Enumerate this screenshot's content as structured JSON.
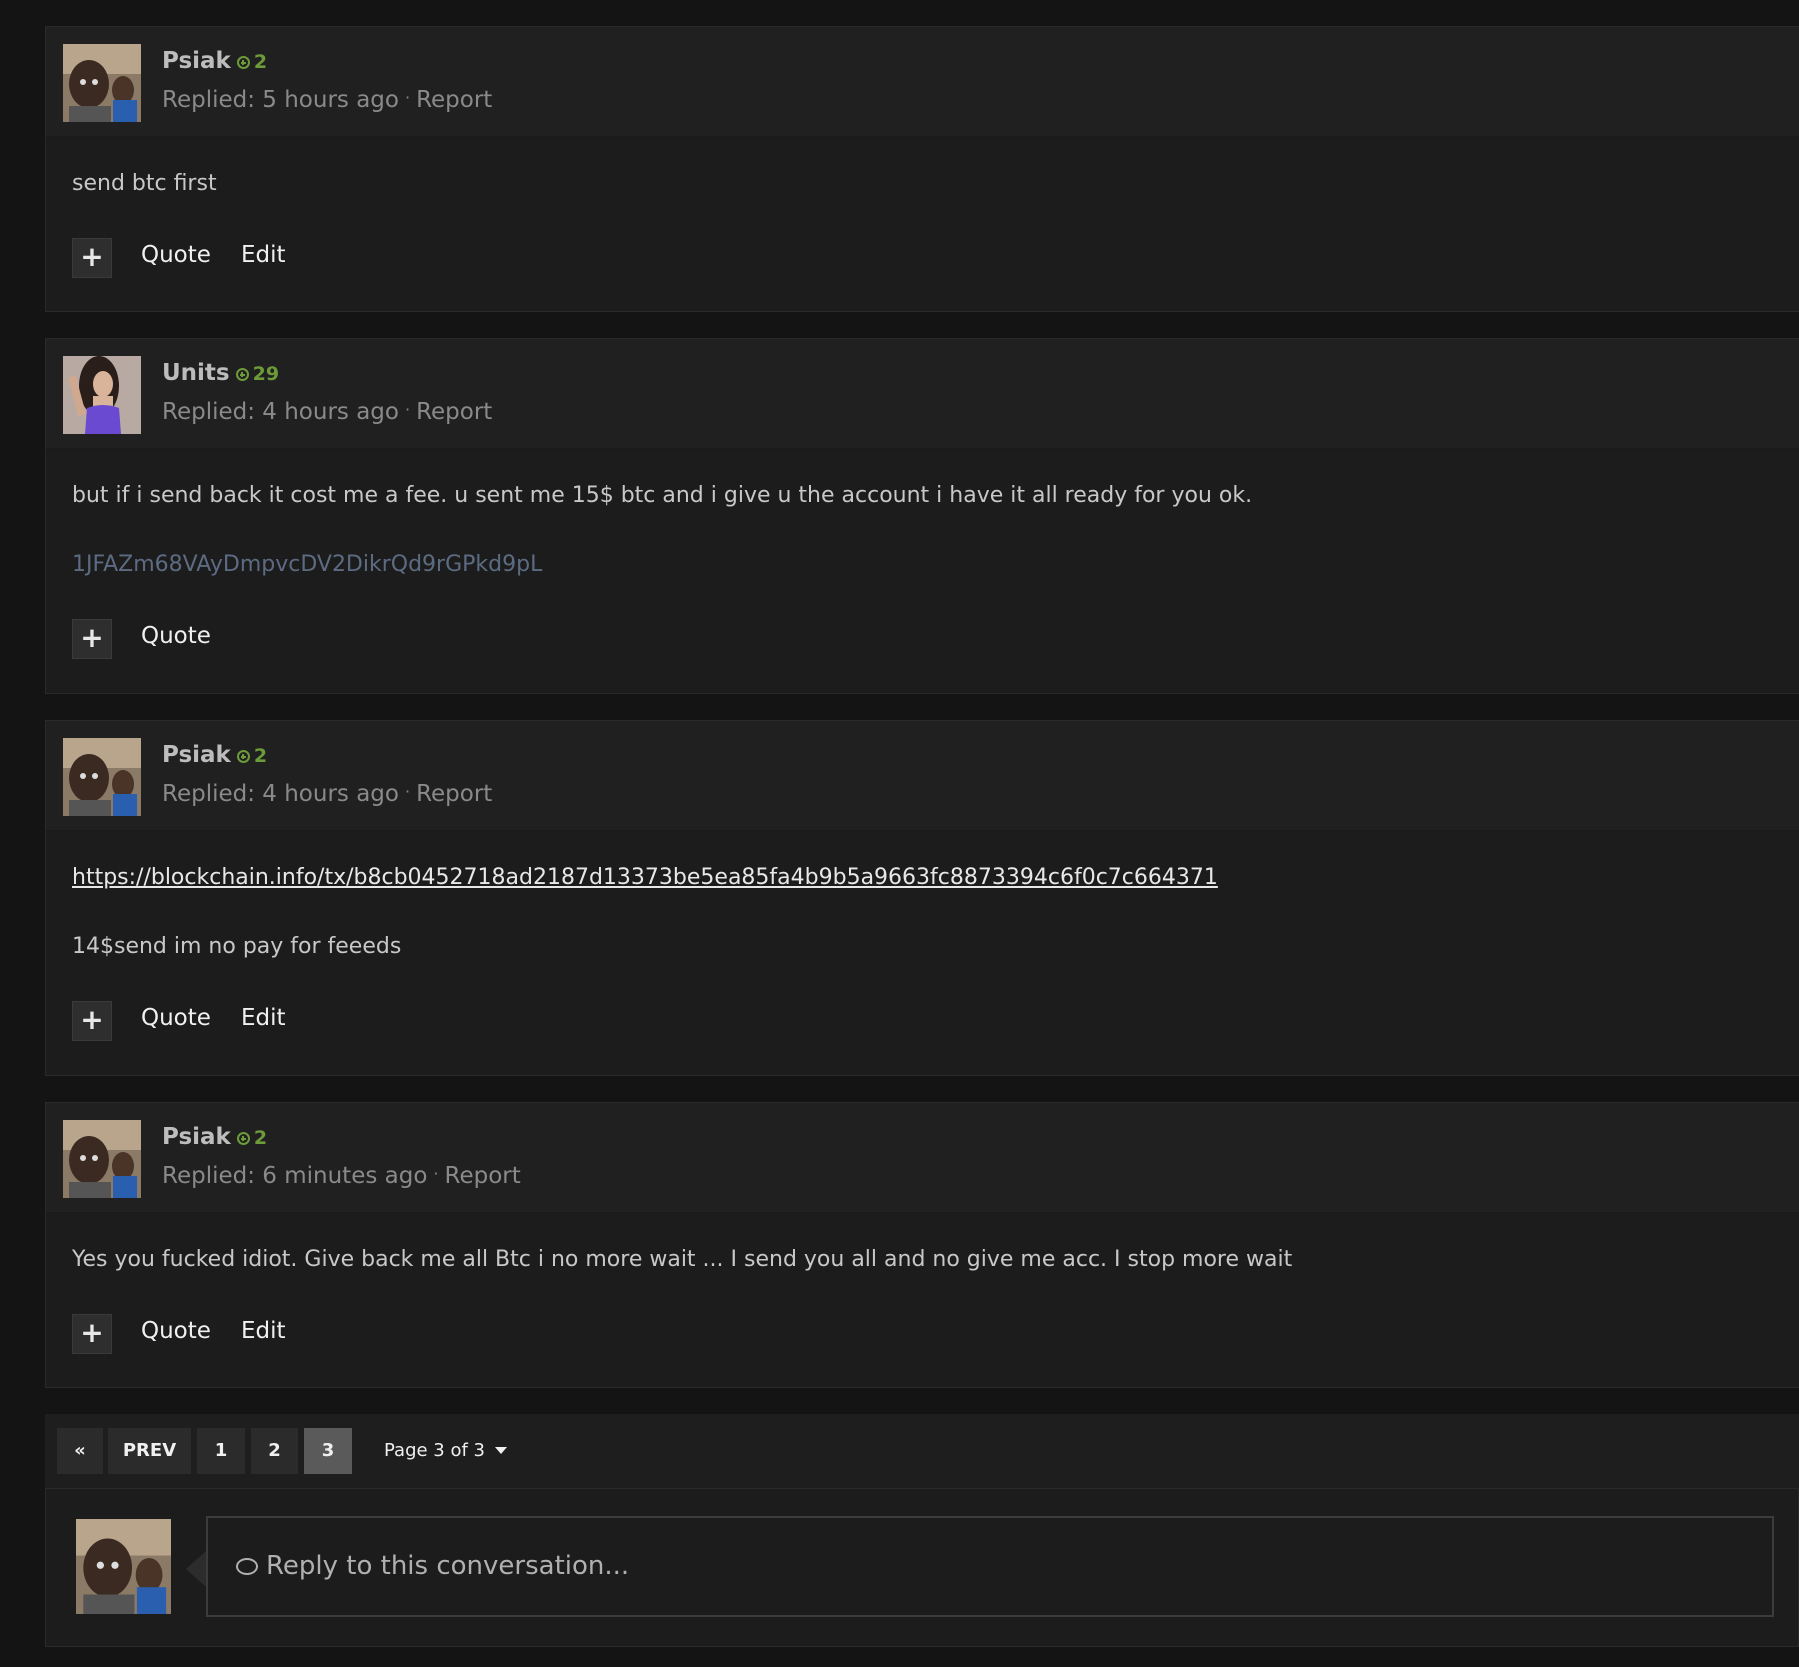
{
  "posts": [
    {
      "author": "Psiak",
      "rep": "2",
      "replied": "Replied: 5 hours ago",
      "report": "Report",
      "body": [
        {
          "type": "text",
          "text": "send btc first"
        }
      ],
      "actions": {
        "plus": "+",
        "quote": "Quote",
        "edit": "Edit"
      }
    },
    {
      "author": "Units",
      "rep": "29",
      "replied": "Replied: 4 hours ago",
      "report": "Report",
      "body": [
        {
          "type": "text",
          "text": "but if i send back it cost me a fee. u sent me 15$ btc and i give u the account i have it all ready for you ok."
        },
        {
          "type": "addr",
          "text": "1JFAZm68VAyDmpvcDV2DikrQd9rGPkd9pL"
        }
      ],
      "actions": {
        "plus": "+",
        "quote": "Quote",
        "edit": ""
      }
    },
    {
      "author": "Psiak",
      "rep": "2",
      "replied": "Replied: 4 hours ago",
      "report": "Report",
      "body": [
        {
          "type": "link",
          "text": "https://blockchain.info/tx/b8cb0452718ad2187d13373be5ea85fa4b9b5a9663fc8873394c6f0c7c664371"
        },
        {
          "type": "text",
          "text": "14$send im no pay for feeeds"
        }
      ],
      "actions": {
        "plus": "+",
        "quote": "Quote",
        "edit": "Edit"
      }
    },
    {
      "author": "Psiak",
      "rep": "2",
      "replied": "Replied: 6 minutes ago",
      "report": "Report",
      "body": [
        {
          "type": "text",
          "text": "Yes you fucked idiot. Give back me all Btc i no more wait ... I send you all and no give me acc. I stop more wait"
        }
      ],
      "actions": {
        "plus": "+",
        "quote": "Quote",
        "edit": "Edit"
      }
    }
  ],
  "pagination": {
    "first": "«",
    "prev": "PREV",
    "pages": [
      "1",
      "2",
      "3"
    ],
    "active_page": "3",
    "jump": "Page 3 of 3"
  },
  "reply": {
    "placeholder": "Reply to this conversation..."
  },
  "icons": {
    "rep": "plus-circle-icon",
    "reply": "speech-bubble-icon",
    "caret": "caret-down-icon"
  },
  "colors": {
    "rep_green": "#6d9b3a",
    "btc_address": "#5c6b82",
    "active_page": "#5a5a5a"
  }
}
